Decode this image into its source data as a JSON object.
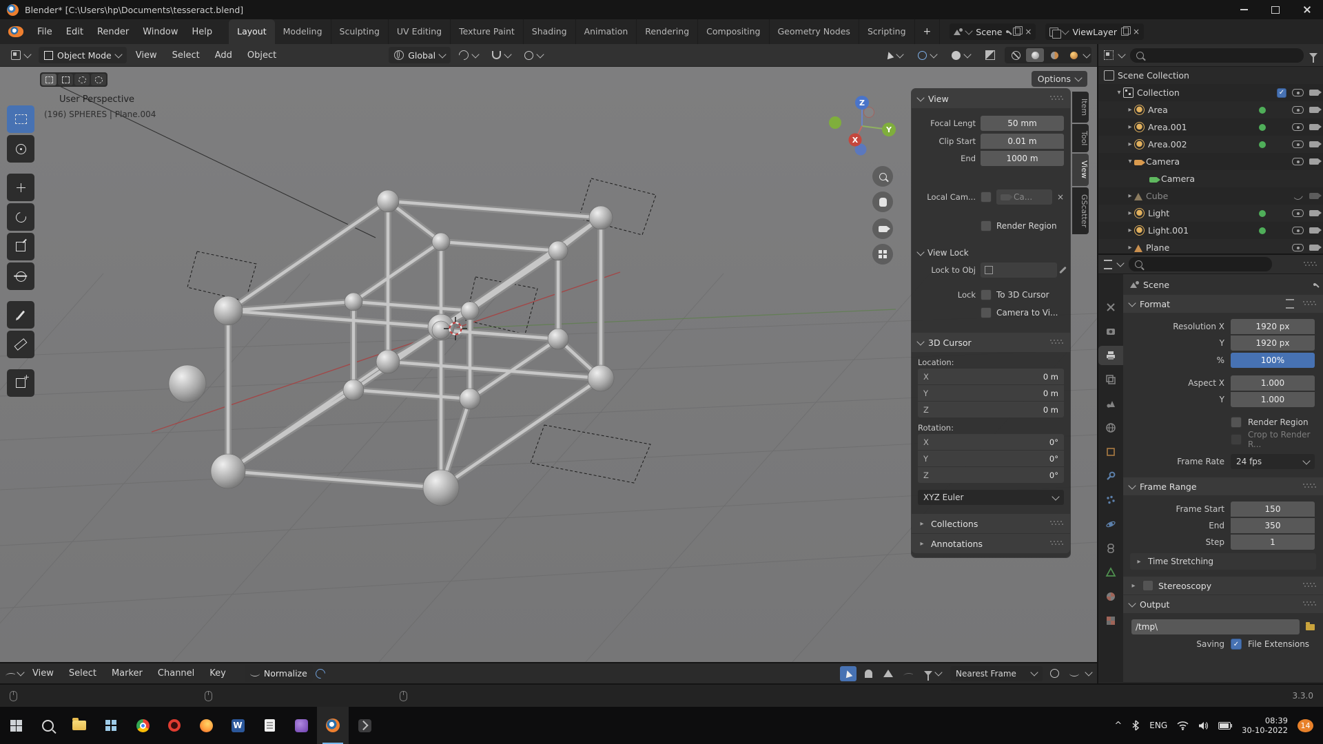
{
  "colors": {
    "accent_blue": "#4772b3",
    "blender_orange": "#ee7f2f",
    "badge_orange": "#e8812a"
  },
  "window": {
    "title": "Blender* [C:\\Users\\hp\\Documents\\tesseract.blend]"
  },
  "topbar": {
    "menus": [
      "File",
      "Edit",
      "Render",
      "Window",
      "Help"
    ],
    "workspaces": [
      "Layout",
      "Modeling",
      "Sculpting",
      "UV Editing",
      "Texture Paint",
      "Shading",
      "Animation",
      "Rendering",
      "Compositing",
      "Geometry Nodes",
      "Scripting"
    ],
    "add_workspace_label": "+",
    "scene_label": "Scene",
    "viewlayer_label": "ViewLayer"
  },
  "tool_header": {
    "mode": "Object Mode",
    "menus": [
      "View",
      "Select",
      "Add",
      "Object"
    ],
    "orientation": "Global"
  },
  "viewport": {
    "options_label": "Options",
    "overlay_title": "User Perspective",
    "overlay_subtitle": "(196) SPHERES | Plane.004",
    "axis_x": "X",
    "axis_y": "Y",
    "axis_z": "Z"
  },
  "sidebar": {
    "tabs": [
      "Item",
      "Tool",
      "View",
      "GScatter"
    ],
    "view_panel": {
      "title": "View",
      "rows": [
        {
          "label": "Focal Lengt",
          "value": "50 mm"
        },
        {
          "label": "Clip Start",
          "value": "0.01 m"
        },
        {
          "label": "End",
          "value": "1000 m"
        }
      ],
      "local_camera_label": "Local Cam...",
      "local_camera_value": "Ca...",
      "render_region_label": "Render Region"
    },
    "view_lock_panel": {
      "title": "View Lock",
      "lock_to_object_label": "Lock to Obj",
      "lock_label": "Lock",
      "to_3d_cursor_label": "To 3D Cursor",
      "camera_to_view_label": "Camera to Vi..."
    },
    "cursor_panel": {
      "title": "3D Cursor",
      "location_label": "Location:",
      "rotation_label": "Rotation:",
      "location": [
        {
          "axis": "X",
          "value": "0 m"
        },
        {
          "axis": "Y",
          "value": "0 m"
        },
        {
          "axis": "Z",
          "value": "0 m"
        }
      ],
      "rotation": [
        {
          "axis": "X",
          "value": "0°"
        },
        {
          "axis": "Y",
          "value": "0°"
        },
        {
          "axis": "Z",
          "value": "0°"
        }
      ],
      "rotation_order": "XYZ Euler"
    },
    "collections_title": "Collections",
    "annotations_title": "Annotations"
  },
  "outliner": {
    "rows": [
      {
        "name": "Scene Collection"
      },
      {
        "name": "Collection"
      },
      {
        "name": "Area"
      },
      {
        "name": "Area.001"
      },
      {
        "name": "Area.002"
      },
      {
        "name": "Camera"
      },
      {
        "name": "Camera"
      },
      {
        "name": "Cube"
      },
      {
        "name": "Light"
      },
      {
        "name": "Light.001"
      },
      {
        "name": "Plane"
      }
    ]
  },
  "properties": {
    "breadcrumb": "Scene",
    "format_panel": {
      "title": "Format",
      "rows": [
        {
          "label": "Resolution X",
          "value": "1920 px"
        },
        {
          "label": "Y",
          "value": "1920 px"
        },
        {
          "label": "%",
          "value": "100%"
        },
        {
          "label": "Aspect X",
          "value": "1.000"
        },
        {
          "label": "Y",
          "value": "1.000"
        }
      ],
      "render_region_label": "Render Region",
      "crop_label": "Crop to Render R...",
      "frame_rate_label": "Frame Rate",
      "frame_rate_value": "24 fps"
    },
    "frame_range_panel": {
      "title": "Frame Range",
      "rows": [
        {
          "label": "Frame Start",
          "value": "150"
        },
        {
          "label": "End",
          "value": "350"
        },
        {
          "label": "Step",
          "value": "1"
        }
      ],
      "time_stretching_title": "Time Stretching"
    },
    "stereoscopy_title": "Stereoscopy",
    "output_panel": {
      "title": "Output",
      "path": "/tmp\\",
      "saving_label": "Saving",
      "file_extensions_label": "File Extensions"
    }
  },
  "timeline": {
    "menus": [
      "View",
      "Select",
      "Marker",
      "Channel",
      "Key"
    ],
    "normalize_label": "Normalize",
    "snap_value": "Nearest Frame"
  },
  "status_bar": {
    "version": "3.3.0"
  },
  "taskbar": {
    "language": "ENG",
    "time": "08:39",
    "date": "30-10-2022",
    "notification_count": "14"
  }
}
